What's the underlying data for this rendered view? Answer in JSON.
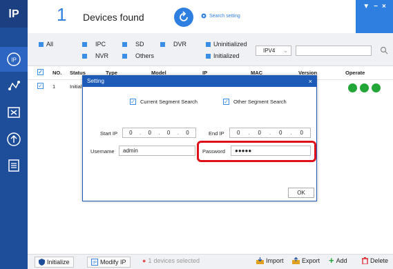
{
  "app": {
    "logo": "ⅠP"
  },
  "sidebar": {
    "items": [
      {
        "icon": "ip-icon",
        "active": true
      },
      {
        "icon": "network-icon",
        "active": false
      },
      {
        "icon": "tools-icon",
        "active": false
      },
      {
        "icon": "upgrade-icon",
        "active": false
      },
      {
        "icon": "docs-icon",
        "active": false
      }
    ]
  },
  "header": {
    "count": "1",
    "found_label": "Devices found",
    "search_setting_label": "Search setting",
    "window_controls": [
      "▼",
      "−",
      "×"
    ]
  },
  "filters": {
    "all": "All",
    "ipc": "IPC",
    "sd": "SD",
    "dvr": "DVR",
    "nvr": "NVR",
    "others": "Others",
    "uninitialized": "Uninitialized",
    "initialized": "Initialized",
    "ip_version": "IPV4",
    "search_value": ""
  },
  "table": {
    "columns": [
      "NO.",
      "Status",
      "Type",
      "Model",
      "IP",
      "MAC",
      "Version",
      "Operate"
    ],
    "rows": [
      {
        "no": "1",
        "status": "Initial"
      }
    ]
  },
  "dialog": {
    "title": "Setting",
    "close": "×",
    "current_segment": "Current Segment Search",
    "other_segment": "Other Segment Search",
    "start_ip_label": "Start IP",
    "end_ip_label": "End IP",
    "start_ip": [
      "0",
      "0",
      "0",
      "0"
    ],
    "end_ip": [
      "0",
      "0",
      "0",
      "0"
    ],
    "username_label": "Username",
    "username": "admin",
    "password_label": "Password",
    "password": "●●●●●",
    "ok": "OK"
  },
  "bottom": {
    "initialize": "Initialize",
    "modify_ip": "Modify IP",
    "selected_count": "1",
    "selected_label": "devices selected",
    "import": "Import",
    "export": "Export",
    "add": "Add",
    "delete": "Delete"
  },
  "colors": {
    "sidebar": "#1e4d99",
    "accent": "#2f7fe0",
    "dialog_title": "#1e5bb8",
    "highlight": "#e0101a",
    "operate_green": "#22a637"
  }
}
